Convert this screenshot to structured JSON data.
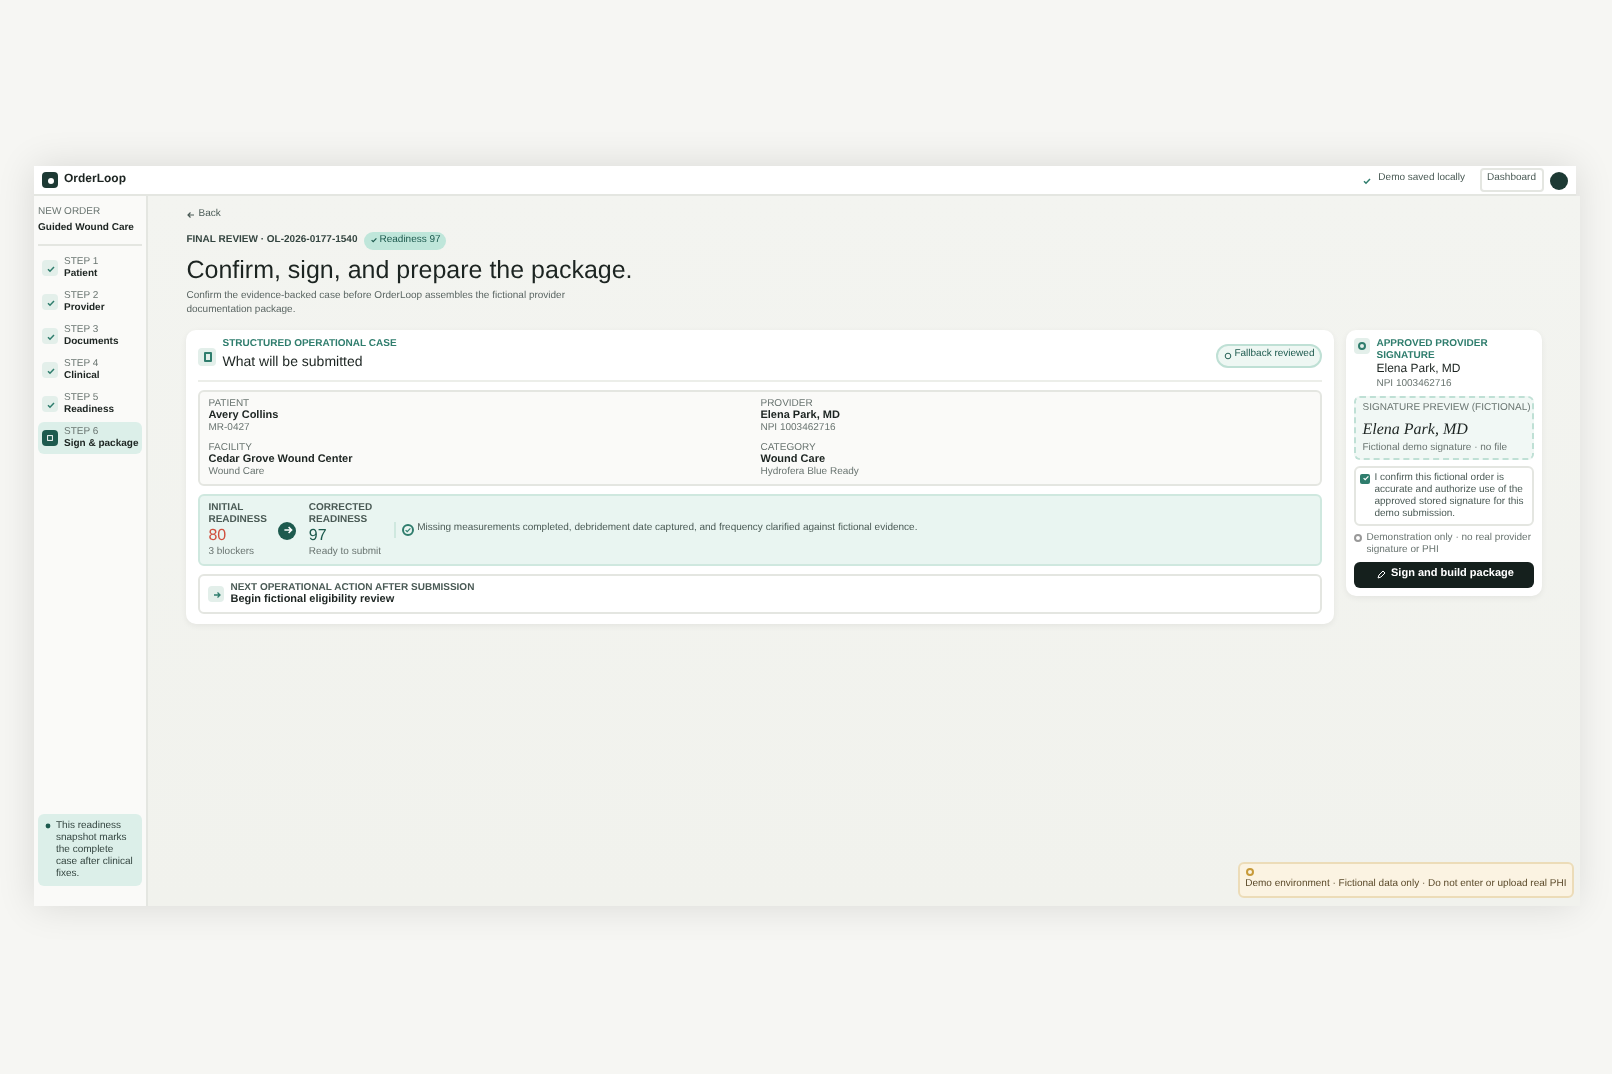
{
  "topbar": {
    "app_name": "OrderLoop",
    "save_status": "Demo saved locally",
    "dashboard": "Dashboard"
  },
  "sidebar": {
    "eyebrow": "NEW ORDER",
    "title": "Guided Wound Care",
    "steps": [
      {
        "step": "STEP 1",
        "label": "Patient",
        "done": true,
        "selected": false
      },
      {
        "step": "STEP 2",
        "label": "Provider",
        "done": true,
        "selected": false
      },
      {
        "step": "STEP 3",
        "label": "Documents",
        "done": true,
        "selected": false
      },
      {
        "step": "STEP 4",
        "label": "Clinical",
        "done": true,
        "selected": false
      },
      {
        "step": "STEP 5",
        "label": "Readiness",
        "done": true,
        "selected": false
      },
      {
        "step": "STEP 6",
        "label": "Sign & package",
        "done": false,
        "selected": true
      }
    ],
    "note": "This readiness snapshot marks the complete case after clinical fixes."
  },
  "main": {
    "back": "Back",
    "eyebrow": "FINAL REVIEW · OL-2026-0177-1540",
    "badge": "Readiness 97",
    "title": "Confirm, sign, and prepare the package.",
    "subtitle": "Confirm the evidence-backed case before OrderLoop assembles the fictional provider documentation package.",
    "card": {
      "eyebrow": "STRUCTURED OPERATIONAL CASE",
      "title": "What will be submitted",
      "badge": "Fallback reviewed",
      "fields": [
        {
          "label": "PATIENT",
          "value": "Avery Collins",
          "sub": "MR-0427"
        },
        {
          "label": "PROVIDER",
          "value": "Elena Park, MD",
          "sub": "NPI 1003462716"
        },
        {
          "label": "FACILITY",
          "value": "Cedar Grove Wound Center",
          "sub": "Wound Care"
        },
        {
          "label": "CATEGORY",
          "value": "Wound Care",
          "sub": "Hydrofera Blue Ready"
        }
      ],
      "readiness": {
        "initial_label": "INITIAL",
        "initial_sub": "READINESS",
        "initial_value": "80",
        "initial_note": "3 blockers",
        "corrected_label": "CORRECTED",
        "corrected_sub": "READINESS",
        "corrected_value": "97",
        "corrected_note": "Ready to submit",
        "message": "Missing measurements completed, debridement date captured, and frequency clarified against fictional evidence."
      },
      "next": {
        "label": "NEXT OPERATIONAL ACTION AFTER SUBMISSION",
        "value": "Begin fictional eligibility review"
      }
    }
  },
  "signature": {
    "eyebrow": "APPROVED PROVIDER SIGNATURE",
    "name": "Elena Park, MD",
    "npi": "NPI 1003462716",
    "preview_label": "SIGNATURE PREVIEW (FICTIONAL)",
    "signature": "Elena Park, MD",
    "caption": "Fictional demo signature · no file",
    "confirm": {
      "checked": true,
      "text": "I confirm this fictional order is accurate and authorize use of the approved stored signature for this demo submission."
    },
    "notice": "Demonstration only · no real provider signature or PHI",
    "button": "Sign and build package"
  },
  "toast": "Demo environment · Fictional data only · Do not enter or upload real PHI"
}
